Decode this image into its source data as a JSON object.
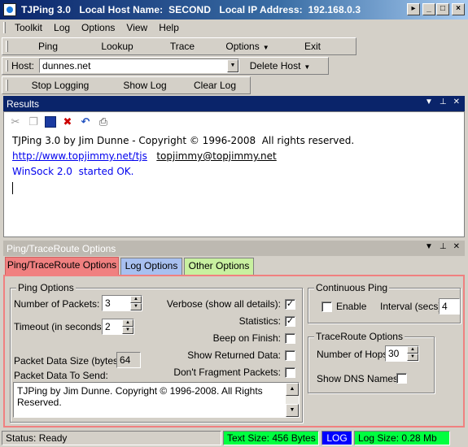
{
  "window": {
    "title": "TJPing 3.0   Local Host Name:  SECOND   Local IP Address:  192.168.0.3",
    "buttons": {
      "scroll": "▸",
      "minimize": "_",
      "maximize": "□",
      "close": "×"
    }
  },
  "menu": [
    "Toolkit",
    "Log",
    "Options",
    "View",
    "Help"
  ],
  "toolbar_main": {
    "ping": "Ping",
    "lookup": "Lookup",
    "trace": "Trace",
    "options": "Options",
    "exit": "Exit"
  },
  "host_bar": {
    "label": "Host:",
    "value": "dunnes.net",
    "delete_host": "Delete Host"
  },
  "log_bar": {
    "stop_logging": "Stop Logging",
    "show_log": "Show Log",
    "clear_log": "Clear Log"
  },
  "results": {
    "header": "Results",
    "icons": [
      "cut-icon",
      "copy-icon",
      "select-all-icon",
      "delete-icon",
      "undo-icon",
      "print-icon"
    ],
    "line1": "TJPing 3.0 by Jim Dunne - Copyright © 1996-2008  All rights reserved.",
    "url": "http://www.topjimmy.net/tjs",
    "email": "topjimmy@topjimmy.net",
    "line3": "WinSock 2.0  started OK."
  },
  "options_pane": {
    "header": "Ping/TraceRoute Options",
    "tabs": {
      "ping": "Ping/TraceRoute Options",
      "log": "Log Options",
      "other": "Other Options"
    },
    "ping_options": {
      "legend": "Ping Options",
      "num_packets_label": "Number of Packets:",
      "num_packets": "3",
      "timeout_label": "Timeout (in seconds):",
      "timeout": "2",
      "packet_size_label": "Packet Data Size (bytes):",
      "packet_size": "64",
      "packet_data_label": "Packet Data To Send:",
      "packet_data": "TJPing by Jim Dunne. Copyright © 1996-2008. All Rights Reserved.",
      "verbose_label": "Verbose (show all details):",
      "verbose": true,
      "statistics_label": "Statistics:",
      "statistics": true,
      "beep_label": "Beep on Finish:",
      "beep": false,
      "show_returned_label": "Show Returned Data:",
      "show_returned": false,
      "dont_fragment_label": "Don't Fragment Packets:",
      "dont_fragment": false
    },
    "continuous_ping": {
      "legend": "Continuous Ping",
      "enable_label": "Enable",
      "enable": false,
      "interval_label": "Interval (secs):",
      "interval": "4"
    },
    "traceroute_options": {
      "legend": "TraceRoute Options",
      "hops_label": "Number of Hops:",
      "hops": "30",
      "dns_label": "Show DNS Names:",
      "dns": false
    }
  },
  "status": {
    "status": "Status: Ready",
    "text_size": "Text Size: 456 Bytes",
    "log": "LOG",
    "log_size": "Log Size: 0.28 Mb",
    "colors": {
      "text_size_bg": "#00ff40",
      "log_bg": "#0000ff",
      "log_size_bg": "#00ff40"
    }
  }
}
